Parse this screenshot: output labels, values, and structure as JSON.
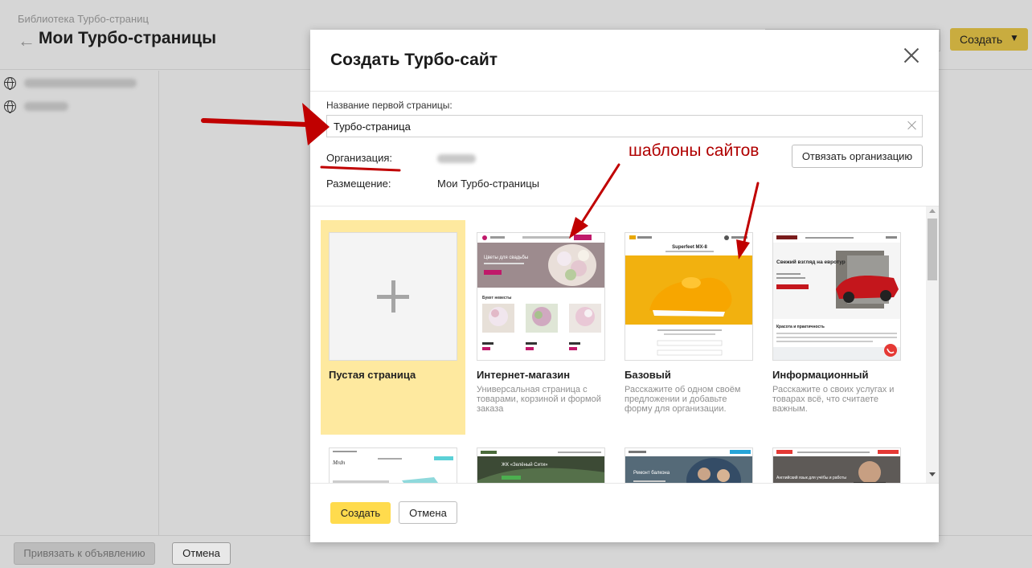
{
  "background": {
    "breadcrumb": "Библиотека Турбо-страниц",
    "title": "Мои Турбо-страницы",
    "create_label": "Создать",
    "bind_label": "Привязать к объявлению",
    "cancel_label": "Отмена"
  },
  "modal": {
    "title": "Создать Турбо-сайт",
    "name_label": "Название первой страницы:",
    "name_value": "Турбо-страница",
    "org_label": "Организация:",
    "placement_label": "Размещение:",
    "placement_value": "Мои Турбо-страницы",
    "unbind_label": "Отвязать организацию",
    "templates": [
      {
        "name": "Пустая страница",
        "desc": ""
      },
      {
        "name": "Интернет-магазин",
        "desc": "Универсальная страница с товарами, корзиной и формой заказа"
      },
      {
        "name": "Базовый",
        "desc": "Расскажите об одном своём предложении и добавьте форму для организации."
      },
      {
        "name": "Информационный",
        "desc": "Расскажите о своих услугах и товарах всё, что считаете важным."
      }
    ],
    "thumbs": {
      "shop_hero": "Цветы для свадьбы",
      "shop_section": "Букет невесты",
      "basic_title": "Superfeet MX-8",
      "info_hero": "Свежий взгляд на евротур",
      "info_section": "Красота и практичность",
      "row2_1": "Mrdn",
      "row2_2": "ЖК «Зелёный Сити»",
      "row2_3": "Ремонт балкона",
      "row2_4": "Английский язык для учёбы и работы"
    },
    "create_label": "Создать",
    "cancel_label": "Отмена"
  },
  "annotation": {
    "text": "шаблоны сайтов",
    "color": "#c00000"
  },
  "colors": {
    "accent": "#ffdb4d",
    "selected_bg": "#fee99f"
  }
}
